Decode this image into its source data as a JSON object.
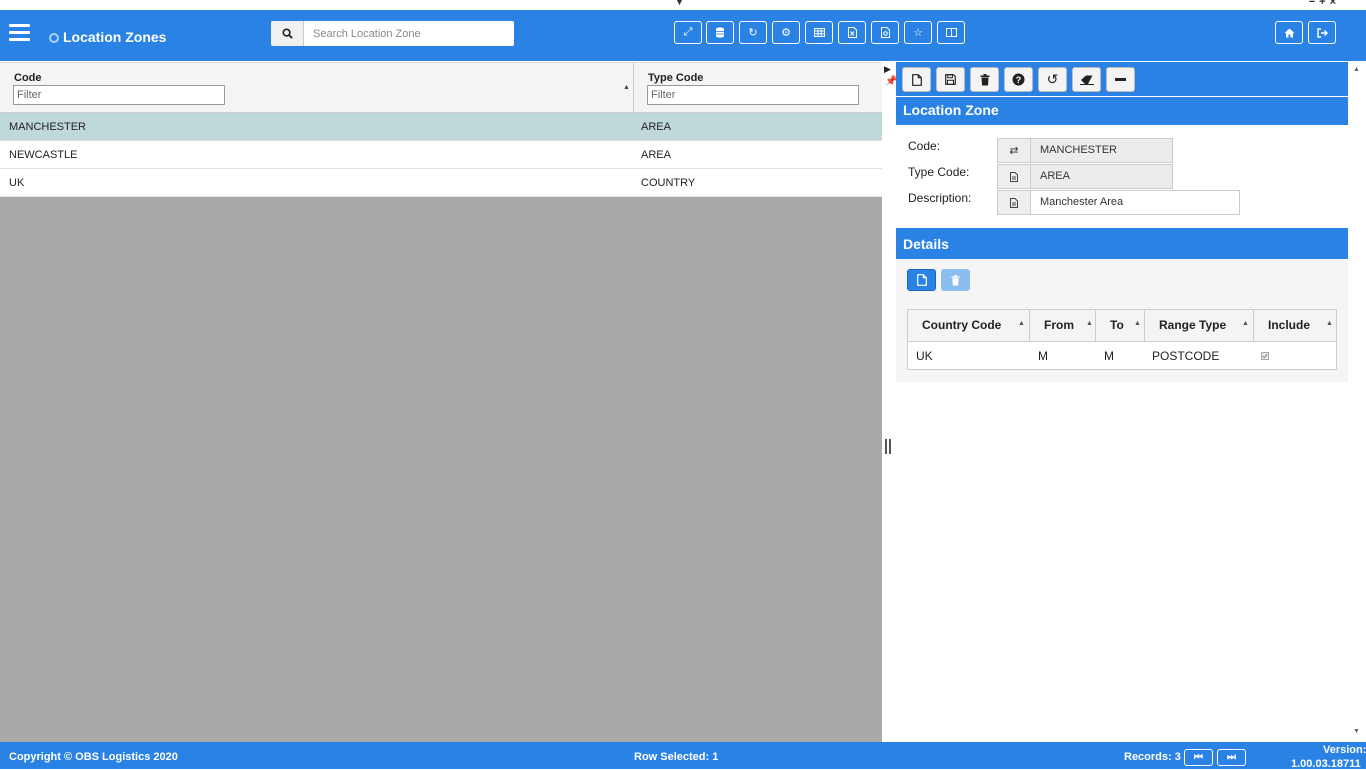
{
  "window": {
    "controls": [
      "−",
      "+",
      "×"
    ]
  },
  "header": {
    "title": "Location Zones",
    "search": {
      "placeholder": "Search Location Zone",
      "value": ""
    },
    "toolbar_icons": [
      "expand-icon",
      "database-icon",
      "refresh-icon",
      "settings-cogs-icon",
      "table-icon",
      "excel-export-icon",
      "pdf-export-icon",
      "star-icon",
      "columns-icon"
    ],
    "right_icons": [
      "home-icon",
      "logout-icon"
    ]
  },
  "grid": {
    "columns": [
      {
        "label": "Code",
        "filter_placeholder": "Filter"
      },
      {
        "label": "Type Code",
        "filter_placeholder": "Filter"
      }
    ],
    "rows": [
      {
        "code": "MANCHESTER",
        "type_code": "AREA",
        "selected": true
      },
      {
        "code": "NEWCASTLE",
        "type_code": "AREA",
        "selected": false
      },
      {
        "code": "UK",
        "type_code": "COUNTRY",
        "selected": false
      }
    ]
  },
  "detail_toolbar_icons": [
    "new-icon",
    "save-icon",
    "delete-icon",
    "help-icon",
    "undo-icon",
    "eraser-icon",
    "minimize-icon"
  ],
  "form": {
    "section_title": "Location Zone",
    "code_label": "Code:",
    "code_value": "MANCHESTER",
    "type_code_label": "Type Code:",
    "type_code_value": "AREA",
    "description_label": "Description:",
    "description_value": "Manchester Area"
  },
  "details": {
    "section_title": "Details",
    "columns": [
      "Country Code",
      "From",
      "To",
      "Range Type",
      "Include"
    ],
    "rows": [
      {
        "country_code": "UK",
        "from": "M",
        "to": "M",
        "range_type": "POSTCODE",
        "include": true
      }
    ]
  },
  "footer": {
    "copyright": "Copyright © OBS Logistics 2020",
    "row_selected": "Row Selected: 1",
    "records": "Records: 3",
    "version_label": "Version:",
    "version": "1.00.03.18711"
  },
  "colors": {
    "primary": "#2a82e4",
    "selected_row": "#bfd8da",
    "empty_area": "#a9a9a9"
  }
}
